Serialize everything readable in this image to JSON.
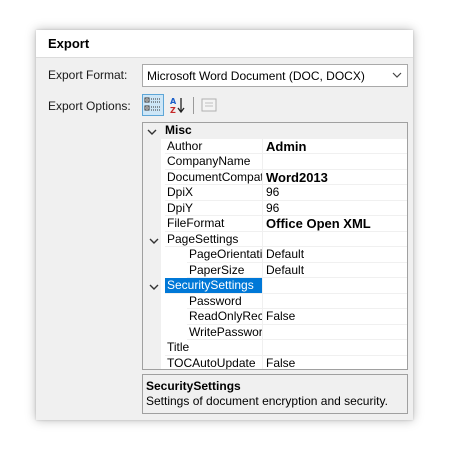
{
  "section_title": "Export",
  "export_format": {
    "label": "Export Format:",
    "value": "Microsoft Word Document (DOC, DOCX)"
  },
  "export_options": {
    "label": "Export Options:"
  },
  "toolbar": {
    "buttons": [
      {
        "name": "categorized-view-button",
        "icon": "categorized-icon",
        "active": true
      },
      {
        "name": "alphabetical-sort-button",
        "icon": "sort-az-icon",
        "active": false
      },
      {
        "name": "property-pages-button",
        "icon": "property-pages-icon",
        "active": false,
        "disabled": true
      }
    ]
  },
  "property_grid": {
    "rows": [
      {
        "kind": "category",
        "name": "Misc",
        "expanded": true
      },
      {
        "kind": "property",
        "name": "Author",
        "value": "Admin",
        "bold": true,
        "indent": 1
      },
      {
        "kind": "property",
        "name": "CompanyName",
        "value": "",
        "indent": 1
      },
      {
        "kind": "property",
        "name": "DocumentCompatib",
        "value": "Word2013",
        "bold": true,
        "indent": 1
      },
      {
        "kind": "property",
        "name": "DpiX",
        "value": "96",
        "indent": 1
      },
      {
        "kind": "property",
        "name": "DpiY",
        "value": "96",
        "indent": 1
      },
      {
        "kind": "property",
        "name": "FileFormat",
        "value": "Office Open XML",
        "bold": true,
        "indent": 1
      },
      {
        "kind": "group",
        "name": "PageSettings",
        "value": "",
        "expanded": true,
        "indent": 1
      },
      {
        "kind": "property",
        "name": "PageOrientatior",
        "value": "Default",
        "indent": 2
      },
      {
        "kind": "property",
        "name": "PaperSize",
        "value": "Default",
        "indent": 2
      },
      {
        "kind": "group",
        "name": "SecuritySettings",
        "value": "",
        "expanded": true,
        "selected": true,
        "indent": 1
      },
      {
        "kind": "property",
        "name": "Password",
        "value": "",
        "indent": 2
      },
      {
        "kind": "property",
        "name": "ReadOnlyReco",
        "value": "False",
        "indent": 2
      },
      {
        "kind": "property",
        "name": "WritePassword",
        "value": "",
        "indent": 2
      },
      {
        "kind": "property",
        "name": "Title",
        "value": "",
        "indent": 1
      },
      {
        "kind": "property",
        "name": "TOCAutoUpdate",
        "value": "False",
        "indent": 1
      }
    ]
  },
  "help_panel": {
    "title": "SecuritySettings",
    "description": "Settings of document encryption and security."
  },
  "colors": {
    "selection": "#0078d7",
    "category_bg": "#f0f0f0",
    "active_button_bg": "#cde6f7"
  }
}
